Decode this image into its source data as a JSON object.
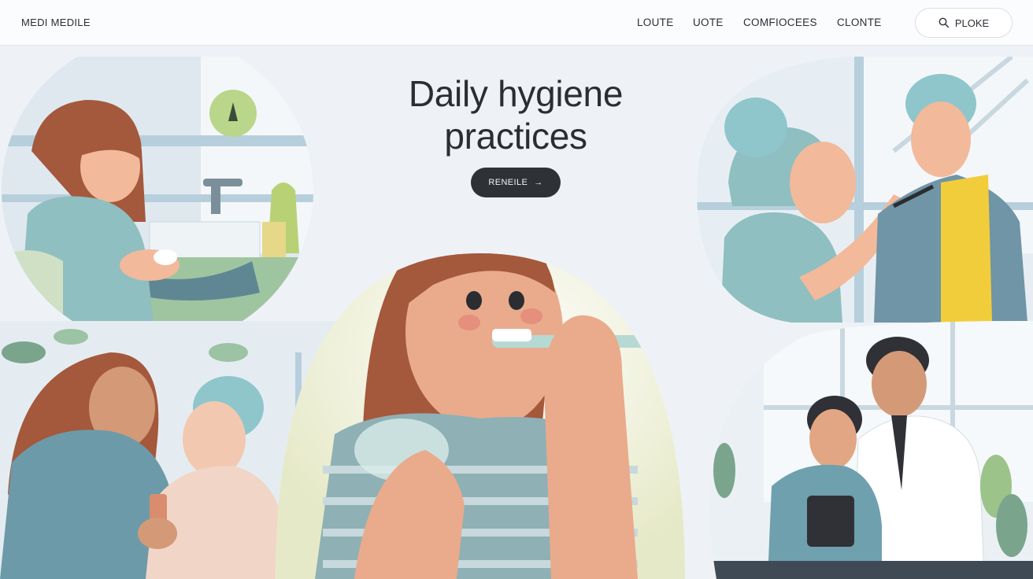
{
  "header": {
    "logo": "MEDI MEDILE",
    "nav": [
      "LOUTE",
      "UOTE",
      "COMFIOCEES",
      "CLONTE"
    ],
    "search_label": "PLOKE"
  },
  "hero": {
    "title_line1": "Daily hygiene",
    "title_line2": "practices",
    "cta_label": "RENEILE",
    "cta_arrow": "→"
  },
  "illustrations": [
    "hand-washing-scene",
    "caregiver-hair-care-scene",
    "helping-elder-scene",
    "tooth-brushing-scene",
    "doctor-consultation-scene"
  ],
  "colors": {
    "background": "#eef2f6",
    "skin": "#f2b99a",
    "hair_brown": "#a4583c",
    "teal_shirt": "#8fbfc0",
    "button_dark": "#2e3136"
  }
}
